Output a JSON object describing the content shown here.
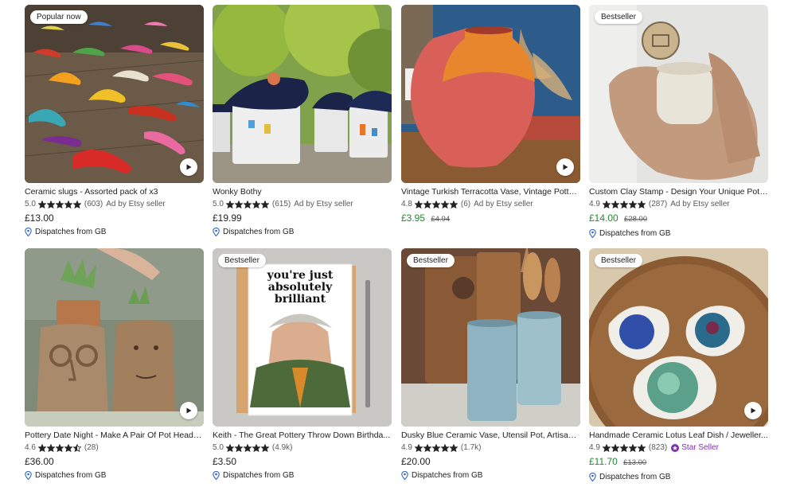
{
  "listings": [
    {
      "badge": "Popular now",
      "title": "Ceramic slugs - Assorted pack of x3",
      "rating": "5.0",
      "reviews": "(603)",
      "ad": "Ad by Etsy seller",
      "price": "£13.00",
      "sale": false,
      "original_price": "",
      "shipping": "Dispatches from GB",
      "video": true,
      "star_seller": ""
    },
    {
      "badge": "",
      "title": "Wonky Bothy",
      "rating": "5.0",
      "reviews": "(615)",
      "ad": "Ad by Etsy seller",
      "price": "£19.99",
      "sale": false,
      "original_price": "",
      "shipping": "Dispatches from GB",
      "video": false,
      "star_seller": ""
    },
    {
      "badge": "",
      "title": "Vintage Turkish Terracotta Vase, Vintage Potte...",
      "rating": "4.8",
      "reviews": "(6)",
      "ad": "Ad by Etsy seller",
      "price": "£3.95",
      "sale": true,
      "original_price": "£4.94",
      "shipping": "",
      "video": true,
      "star_seller": ""
    },
    {
      "badge": "Bestseller",
      "title": "Custom Clay Stamp - Design Your Unique Pott...",
      "rating": "4.9",
      "reviews": "(287)",
      "ad": "Ad by Etsy seller",
      "price": "£14.00",
      "sale": true,
      "original_price": "£28.00",
      "shipping": "Dispatches from GB",
      "video": false,
      "star_seller": ""
    },
    {
      "badge": "",
      "title": "Pottery Date Night - Make A Pair Of Pot Heads ...",
      "rating": "4.6",
      "reviews": "(28)",
      "ad": "",
      "price": "£36.00",
      "sale": false,
      "original_price": "",
      "shipping": "Dispatches from GB",
      "video": true,
      "star_seller": ""
    },
    {
      "badge": "Bestseller",
      "title": "Keith - The Great Pottery Throw Down Birthda...",
      "rating": "5.0",
      "reviews": "(4.9k)",
      "ad": "",
      "price": "£3.50",
      "sale": false,
      "original_price": "",
      "shipping": "Dispatches from GB",
      "video": false,
      "star_seller": "",
      "card_text": "you're just absolutely brilliant"
    },
    {
      "badge": "Bestseller",
      "title": "Dusky Blue Ceramic Vase, Utensil Pot, Artisan ...",
      "rating": "4.9",
      "reviews": "(1.7k)",
      "ad": "",
      "price": "£20.00",
      "sale": false,
      "original_price": "",
      "shipping": "Dispatches from GB",
      "video": false,
      "star_seller": ""
    },
    {
      "badge": "Bestseller",
      "title": "Handmade Ceramic Lotus Leaf Dish / Jeweller...",
      "rating": "4.9",
      "reviews": "(823)",
      "ad": "",
      "price": "£11.70",
      "sale": true,
      "original_price": "£13.00",
      "shipping": "Dispatches from GB",
      "video": true,
      "star_seller": "Star Seller"
    }
  ],
  "colors": {
    "sale_price": "#258635",
    "star": "#222222",
    "star_seller": "#7d2fae",
    "pin": "#2f64c4"
  },
  "icons": {
    "play": "play-icon",
    "star": "star-icon",
    "pin": "location-pin-icon",
    "star_seller": "star-seller-badge-icon"
  }
}
